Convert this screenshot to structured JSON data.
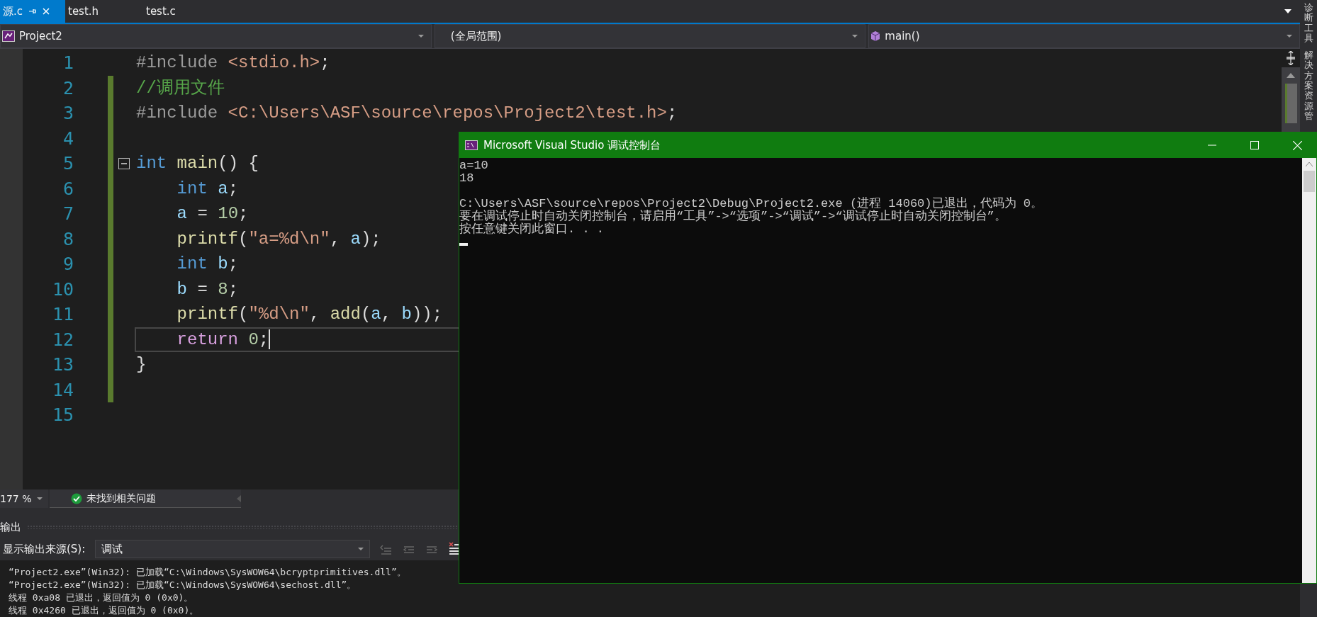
{
  "tabs": [
    {
      "label": "源.c",
      "selected": true,
      "pinned": true
    },
    {
      "label": "test.h",
      "selected": false,
      "pinned": false
    },
    {
      "label": "test.c",
      "selected": false,
      "pinned": false
    }
  ],
  "nav_bar": {
    "project": "Project2",
    "scope": "(全局范围)",
    "member": "main()"
  },
  "editor": {
    "lines": [
      {
        "number": "1",
        "changed": false,
        "current": false,
        "tokens": [
          {
            "kind": "preproc",
            "text": "#include"
          },
          {
            "kind": "include",
            "text": " <stdio.h>"
          },
          {
            "kind": "punct",
            "text": ";"
          }
        ]
      },
      {
        "number": "2",
        "changed": true,
        "current": false,
        "tokens": [
          {
            "kind": "comment",
            "text": "//调用文件"
          }
        ]
      },
      {
        "number": "3",
        "changed": true,
        "current": false,
        "tokens": [
          {
            "kind": "preproc",
            "text": "#include"
          },
          {
            "kind": "include",
            "text": " <C:\\Users\\ASF\\source\\repos\\Project2\\test.h>"
          },
          {
            "kind": "punct",
            "text": ";"
          }
        ]
      },
      {
        "number": "4",
        "changed": true,
        "current": false
      },
      {
        "number": "5",
        "changed": true,
        "current": false,
        "collapsible": true,
        "tokens": [
          {
            "kind": "keyword",
            "text": "int"
          },
          {
            "kind": "func",
            "text": " main"
          },
          {
            "kind": "punct",
            "text": "() {"
          }
        ]
      },
      {
        "number": "6",
        "changed": true,
        "current": false,
        "tokens": [
          {
            "kind": "keyword",
            "text": "    int"
          },
          {
            "kind": "ident",
            "text": " a"
          },
          {
            "kind": "punct",
            "text": ";"
          }
        ]
      },
      {
        "number": "7",
        "changed": true,
        "current": false,
        "tokens": [
          {
            "kind": "ident",
            "text": "    a"
          },
          {
            "kind": "punct",
            "text": " = "
          },
          {
            "kind": "number",
            "text": "10"
          },
          {
            "kind": "punct",
            "text": ";"
          }
        ]
      },
      {
        "number": "8",
        "changed": true,
        "current": false,
        "tokens": [
          {
            "kind": "func",
            "text": "    printf"
          },
          {
            "kind": "punct",
            "text": "("
          },
          {
            "kind": "string",
            "text": "\"a=%d\\n\""
          },
          {
            "kind": "punct",
            "text": ", "
          },
          {
            "kind": "ident",
            "text": "a"
          },
          {
            "kind": "punct",
            "text": ");"
          }
        ]
      },
      {
        "number": "9",
        "changed": true,
        "current": false,
        "tokens": [
          {
            "kind": "keyword",
            "text": "    int"
          },
          {
            "kind": "ident",
            "text": " b"
          },
          {
            "kind": "punct",
            "text": ";"
          }
        ]
      },
      {
        "number": "10",
        "changed": true,
        "current": false,
        "tokens": [
          {
            "kind": "ident",
            "text": "    b"
          },
          {
            "kind": "punct",
            "text": " = "
          },
          {
            "kind": "number",
            "text": "8"
          },
          {
            "kind": "punct",
            "text": ";"
          }
        ]
      },
      {
        "number": "11",
        "changed": true,
        "current": false,
        "tokens": [
          {
            "kind": "func",
            "text": "    printf"
          },
          {
            "kind": "punct",
            "text": "("
          },
          {
            "kind": "string",
            "text": "\"%d\\n\""
          },
          {
            "kind": "punct",
            "text": ", "
          },
          {
            "kind": "func",
            "text": "add"
          },
          {
            "kind": "punct",
            "text": "("
          },
          {
            "kind": "ident",
            "text": "a"
          },
          {
            "kind": "punct",
            "text": ", "
          },
          {
            "kind": "ident",
            "text": "b"
          },
          {
            "kind": "punct",
            "text": "));"
          }
        ]
      },
      {
        "number": "12",
        "changed": true,
        "current": true,
        "tokens": [
          {
            "kind": "control",
            "text": "    return"
          },
          {
            "kind": "number",
            "text": " 0"
          },
          {
            "kind": "punct",
            "text": ";"
          }
        ]
      },
      {
        "number": "13",
        "changed": true,
        "current": false,
        "tokens": [
          {
            "kind": "punct",
            "text": "}"
          }
        ]
      },
      {
        "number": "14",
        "changed": true,
        "current": false
      },
      {
        "number": "15",
        "changed": false,
        "current": false
      }
    ]
  },
  "status_row": {
    "zoom": "177 %",
    "issues": "未找到相关问题"
  },
  "output_panel": {
    "title": "输出",
    "source_label": "显示输出来源(S):",
    "source": "调试",
    "lines": [
      "“Project2.exe”(Win32): 已加载“C:\\Windows\\SysWOW64\\bcryptprimitives.dll”。",
      "“Project2.exe”(Win32): 已加载“C:\\Windows\\SysWOW64\\sechost.dll”。",
      "线程 0xa08 已退出，返回值为 0 (0x0)。",
      "线程 0x4260 已退出，返回值为 0 (0x0)。"
    ]
  },
  "side_tabs": [
    "诊断工具",
    "解决方案资源管"
  ],
  "console": {
    "title": "Microsoft Visual Studio 调试控制台",
    "lines": [
      {
        "text": "a=10"
      },
      {
        "text": "18"
      },
      {
        "text": "C:\\Users\\ASF\\source\\repos\\Project2\\Debug\\Project2.exe (进程 14060)已退出，代码为 0。",
        "blank_before": true
      },
      {
        "text": "要在调试停止时自动关闭控制台，请启用“工具”->“选项”->“调试”->“调试停止时自动关闭控制台”。"
      },
      {
        "text": "按任意键关闭此窗口. . ."
      }
    ]
  }
}
